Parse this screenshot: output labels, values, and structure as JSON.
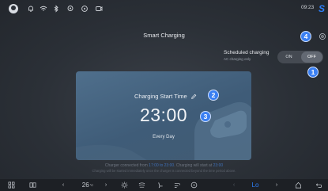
{
  "status_bar": {
    "time": "09:23",
    "icons": [
      "avatar",
      "bell-icon",
      "wifi-icon",
      "bluetooth-icon",
      "location-icon",
      "hotspot-icon",
      "screen-icon",
      "brand-logo"
    ]
  },
  "header": {
    "title": "Smart Charging"
  },
  "scheduled": {
    "label": "Scheduled charging",
    "sublabel": "AC charging only",
    "toggle_on": "ON",
    "toggle_off": "OFF",
    "selected": "OFF"
  },
  "card": {
    "title": "Charging Start Time",
    "time": "23:00",
    "repeat": "Every Day"
  },
  "callouts": {
    "one": "1",
    "two": "2",
    "three": "3",
    "four": "4"
  },
  "info": {
    "line1_prefix": "Charger connected from",
    "line1_range": "17:00 to 23:00",
    "line1_mid": ". Charging will start at",
    "line1_time": "23:00",
    "line2": "Charging will be started immediately once the charger is connected beyond the time period above."
  },
  "dock": {
    "temperature": "26",
    "temperature_unit": "°C",
    "fan_level": "Lo"
  },
  "colors": {
    "accent": "#2d7ef7",
    "badge": "#3a7ff2",
    "card": "#4a6a88"
  }
}
